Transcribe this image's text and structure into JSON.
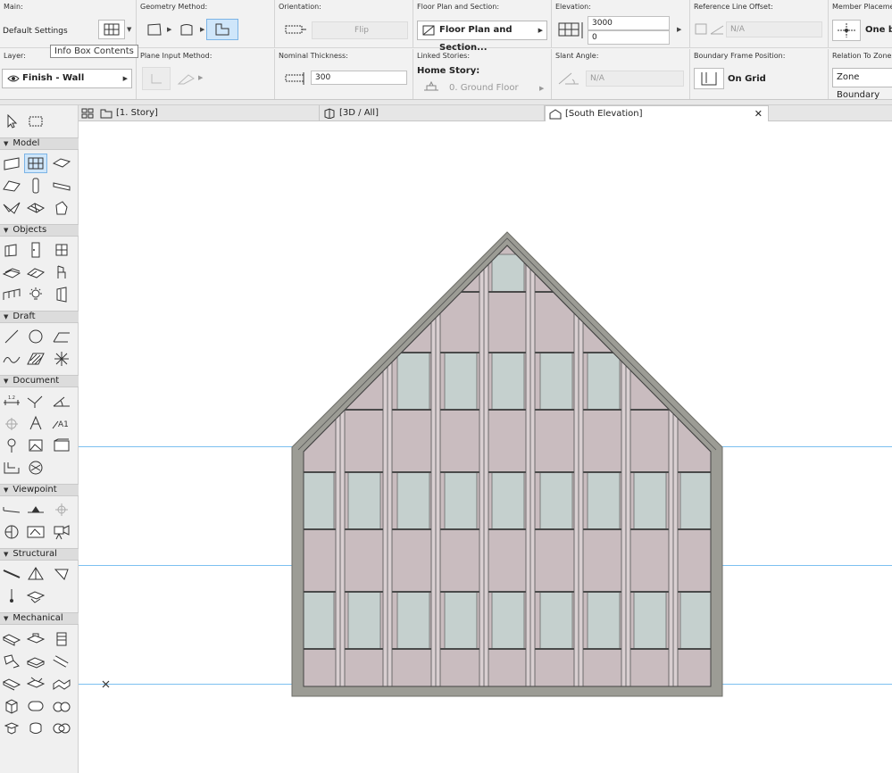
{
  "infobox": {
    "main": {
      "title": "Main:",
      "value": "Default Settings"
    },
    "tooltip": "Info Box Contents",
    "geometry": {
      "title": "Geometry Method:"
    },
    "orientation": {
      "title": "Orientation:",
      "flip": "Flip"
    },
    "floorplan": {
      "title": "Floor Plan and Section:",
      "value": "Floor Plan and Section..."
    },
    "elevation": {
      "title": "Elevation:",
      "top": "3000",
      "bottom": "0"
    },
    "refline": {
      "title": "Reference Line Offset:",
      "value": "N/A"
    },
    "member": {
      "title": "Member Placement:",
      "value": "One by"
    },
    "layer": {
      "title": "Layer:",
      "value": "Finish - Wall"
    },
    "plane": {
      "title": "Plane Input Method:"
    },
    "thickness": {
      "title": "Nominal Thickness:",
      "value": "300"
    },
    "linked": {
      "title": "Linked Stories:",
      "home": "Home Story:",
      "story": "0. Ground Floor"
    },
    "slant": {
      "title": "Slant Angle:",
      "value": "N/A"
    },
    "boundary": {
      "title": "Boundary Frame Position:",
      "value": "On Grid"
    },
    "zones": {
      "title": "Relation To Zones:",
      "value": "Zone Boundary"
    }
  },
  "toolbox": {
    "groups": [
      "Model",
      "Objects",
      "Draft",
      "Document",
      "Viewpoint",
      "Structural",
      "Mechanical"
    ]
  },
  "tabs": [
    {
      "label": "[1. Story]"
    },
    {
      "label": "[3D / All]"
    },
    {
      "label": "[South Elevation]"
    }
  ],
  "colors": {
    "accent": "#7cb4e6",
    "selected": "#cfe6fa",
    "frame": "#9c9c95",
    "panel": "#c9bcbf",
    "glass": "#c5d0ce",
    "storyline": "#7cc0f0"
  }
}
